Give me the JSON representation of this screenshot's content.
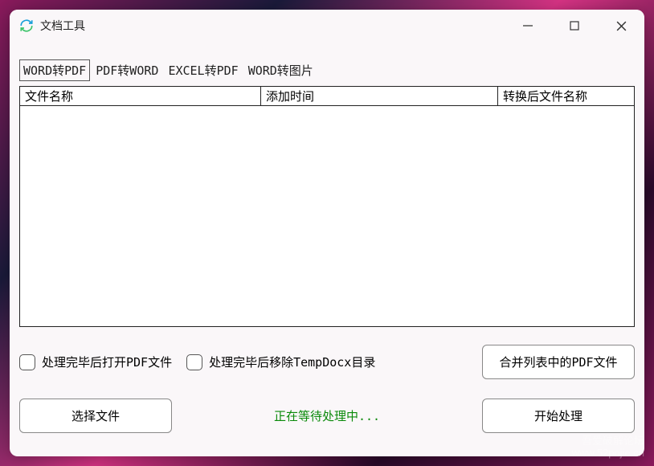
{
  "window": {
    "title": "文档工具"
  },
  "tabs": [
    {
      "label": "WORD转PDF",
      "active": true
    },
    {
      "label": "PDF转WORD",
      "active": false
    },
    {
      "label": "EXCEL转PDF",
      "active": false
    },
    {
      "label": "WORD转图片",
      "active": false
    }
  ],
  "table": {
    "columns": [
      "文件名称",
      "添加时间",
      "转换后文件名称"
    ],
    "rows": []
  },
  "options": {
    "open_pdf_label": "处理完毕后打开PDF文件",
    "remove_temp_label": "处理完毕后移除TempDocx目录"
  },
  "buttons": {
    "merge": "合并列表中的PDF文件",
    "select": "选择文件",
    "start": "开始处理"
  },
  "status": "正在等待处理中...",
  "watermark": {
    "line1": "吾爱破解论坛",
    "line2": "www.52pojie.cn"
  }
}
